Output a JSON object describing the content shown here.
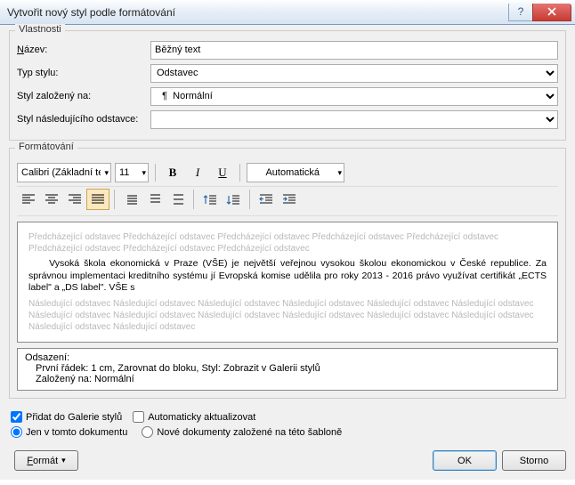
{
  "window": {
    "title": "Vytvořit nový styl podle formátování"
  },
  "groups": {
    "properties": {
      "legend": "Vlastnosti",
      "name_label_pre": "N",
      "name_label": "ázev:",
      "name_value": "Běžný text",
      "type_label": "Typ stylu:",
      "type_value": "Odstavec",
      "basedon_label": "Styl založený na:",
      "basedon_value": "Normální",
      "following_label": "Styl následujícího odstavce:",
      "following_value": ""
    },
    "formatting": {
      "legend": "Formátování",
      "font": "Calibri (Základní te",
      "size": "11",
      "color_label": "Automatická"
    }
  },
  "preview": {
    "ghost_before": "Předcházející odstavec Předcházející odstavec Předcházející odstavec Předcházející odstavec Předcházející odstavec Předcházející odstavec Předcházející odstavec Předcházející odstavec",
    "real_text": "Vysoká škola ekonomická v Praze (VŠE) je největší veřejnou vysokou školou ekonomickou v České republice. Za správnou implementaci kreditního systému jí Evropská komise udělila pro roky 2013 - 2016 právo využívat certifikát „ECTS label\" a „DS label\". VŠE s",
    "ghost_after": "Následující odstavec Následující odstavec Následující odstavec Následující odstavec Následující odstavec Následující odstavec Následující odstavec Následující odstavec Následující odstavec Následující odstavec Následující odstavec Následující odstavec Následující odstavec Následující odstavec"
  },
  "description": {
    "line1": "Odsazení:",
    "line2": "První řádek:  1 cm, Zarovnat do bloku, Styl: Zobrazit v Galerii stylů",
    "line3": "Založený na: Normální"
  },
  "options": {
    "add_gallery": "Přidat do Galerie stylů",
    "auto_update": "Automaticky aktualizovat",
    "this_doc": "Jen v tomto dokumentu",
    "template_docs": "Nové dokumenty založené na této šabloně"
  },
  "buttons": {
    "format_pre": "F",
    "format": "ormát",
    "ok": "OK",
    "cancel": "Storno"
  }
}
